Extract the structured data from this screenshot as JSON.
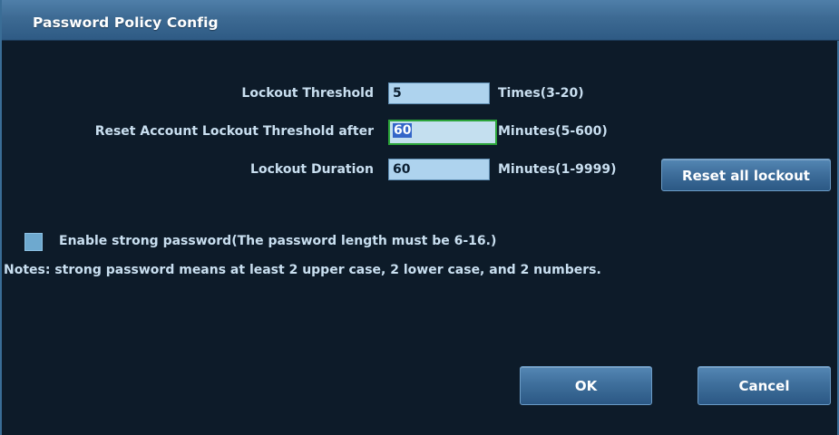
{
  "dialog": {
    "title": "Password Policy Config"
  },
  "fields": {
    "lockout_threshold": {
      "label": "Lockout Threshold",
      "value": "5",
      "unit": "Times(3-20)"
    },
    "reset_after": {
      "label": "Reset Account Lockout Threshold after",
      "value": "60",
      "unit": "Minutes(5-600)"
    },
    "lockout_duration": {
      "label": "Lockout Duration",
      "value": "60",
      "unit": "Minutes(1-9999)"
    }
  },
  "buttons": {
    "reset_all": "Reset all lockout",
    "ok": "OK",
    "cancel": "Cancel"
  },
  "strong_password": {
    "checkbox_label": "Enable strong password(The password length must be 6-16.)",
    "checked": false,
    "notes": "Notes: strong password means at least 2 upper case, 2 lower case, and 2 numbers."
  }
}
